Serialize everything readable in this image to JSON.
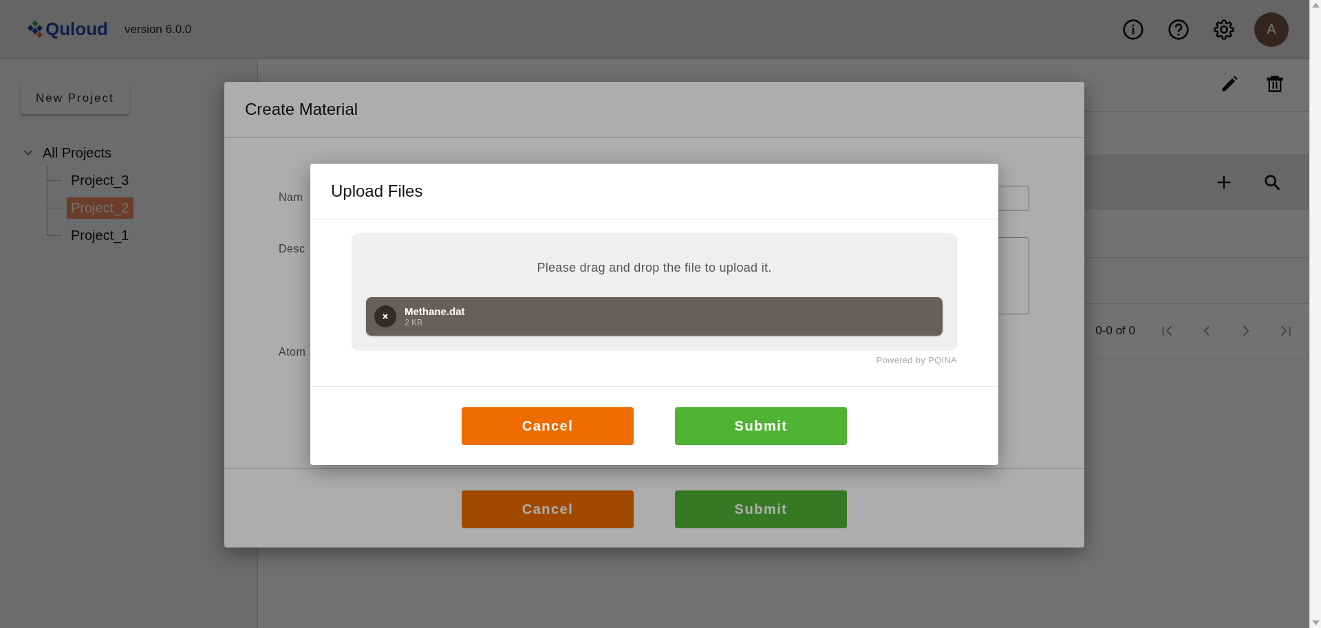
{
  "header": {
    "logo": "Quloud",
    "version": "version 6.0.0",
    "avatar": "A"
  },
  "sidebar": {
    "new_button": "New Project",
    "tree": [
      {
        "label": "All Projects",
        "expanded": true,
        "selected": false,
        "children": [
          {
            "label": "Project_3",
            "selected": false
          },
          {
            "label": "Project_2",
            "selected": true
          },
          {
            "label": "Project_1",
            "selected": false
          }
        ]
      }
    ]
  },
  "main": {
    "pagination": "0-0 of 0"
  },
  "create_dialog": {
    "title": "Create Material",
    "fields": [
      {
        "label": "Nam",
        "kind": "input"
      },
      {
        "label": "Desc",
        "kind": "textarea"
      },
      {
        "label": "Atom",
        "kind": "text"
      }
    ],
    "buttons": [
      {
        "label": "Cancel",
        "kind": "cancel"
      },
      {
        "label": "Submit",
        "kind": "submit"
      }
    ]
  },
  "upload_dialog": {
    "title": "Upload Files",
    "hint": "Please drag and drop the file to upload it.",
    "files": [
      {
        "name": "Methane.dat",
        "size": "2 KB"
      }
    ],
    "credit": "Powered by PQINA",
    "buttons": [
      {
        "label": "Cancel",
        "kind": "cancel"
      },
      {
        "label": "Submit",
        "kind": "submit"
      }
    ]
  }
}
